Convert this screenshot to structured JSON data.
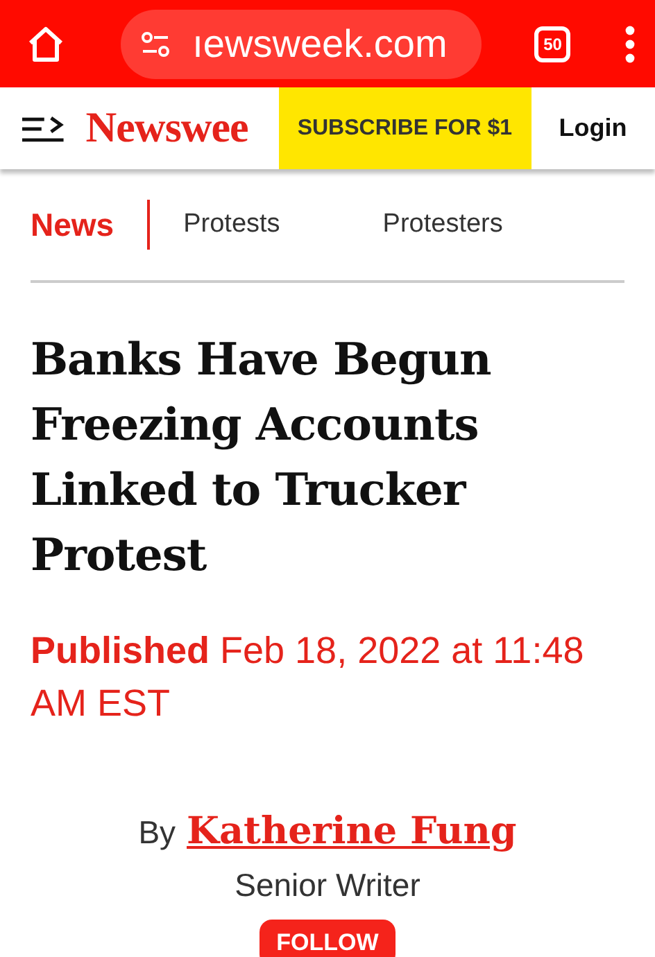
{
  "browser_bar": {
    "url": "ıewsweek.com",
    "tab_count": "50"
  },
  "site_header": {
    "logo": "Newswee",
    "subscribe": "SUBSCRIBE FOR $1",
    "login": "Login"
  },
  "tabs": [
    {
      "label": "News",
      "selected": true
    },
    {
      "label": "Protests",
      "selected": false
    },
    {
      "label": "Protesters",
      "selected": false
    }
  ],
  "article": {
    "headline": "Banks Have Begun Freezing Accounts Linked to Trucker Protest",
    "published": "**Published** Feb 18, 2022 at 11:48 AM EST",
    "by": "By",
    "author": "Katherine Fung",
    "author_title": "Senior Writer",
    "follow": "FOLLOW"
  }
}
